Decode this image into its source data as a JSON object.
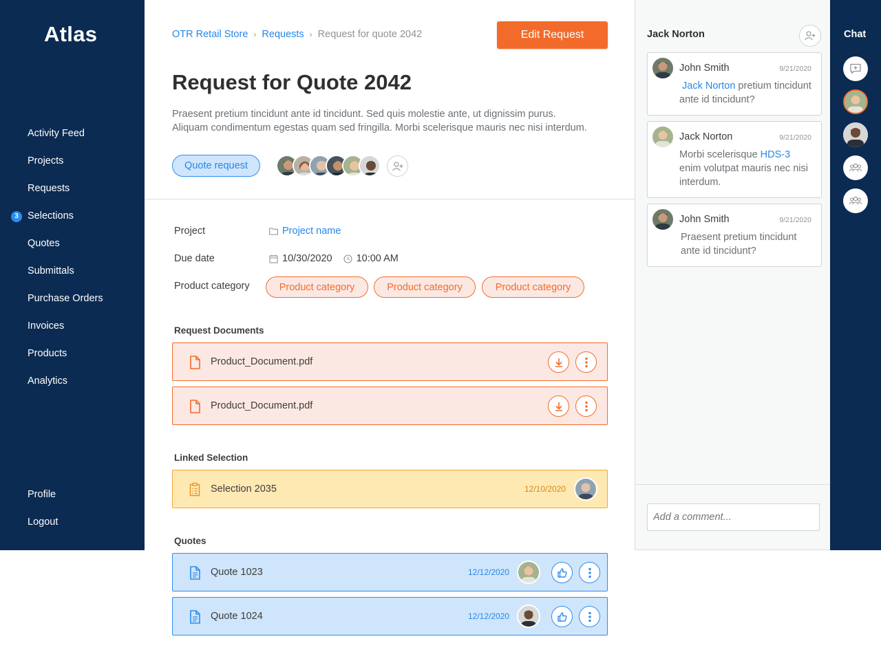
{
  "sidebar": {
    "logo": "Atlas",
    "items": [
      {
        "label": "Activity Feed"
      },
      {
        "label": "Projects"
      },
      {
        "label": "Requests"
      },
      {
        "label": "Selections",
        "badge": "3"
      },
      {
        "label": "Quotes"
      },
      {
        "label": "Submittals"
      },
      {
        "label": "Purchase Orders"
      },
      {
        "label": "Invoices"
      },
      {
        "label": "Products"
      },
      {
        "label": "Analytics"
      }
    ],
    "bottom_items": [
      {
        "label": "Profile"
      },
      {
        "label": "Logout"
      }
    ]
  },
  "breadcrumb": {
    "items": [
      "OTR Retail Store",
      "Requests"
    ],
    "current": "Request for quote 2042"
  },
  "header": {
    "edit_button": "Edit Request",
    "title": "Request for Quote 2042",
    "description_line1": "Praesent pretium tincidunt ante id tincidunt. Sed quis molestie ante, ut dignissim purus.",
    "description_line2": "Aliquam condimentum egestas quam sed fringilla. Morbi scelerisque mauris nec nisi interdum.",
    "type_tag": "Quote request"
  },
  "details": {
    "project_label": "Project",
    "project_value": "Project name",
    "due_label": "Due date",
    "due_date": "10/30/2020",
    "due_time": "10:00 AM",
    "category_label": "Product category",
    "categories": [
      "Product category",
      "Product category",
      "Product category"
    ]
  },
  "request_documents": {
    "title": "Request Documents",
    "items": [
      {
        "name": "Product_Document.pdf"
      },
      {
        "name": "Product_Document.pdf"
      }
    ]
  },
  "linked_selection": {
    "title": "Linked Selection",
    "name": "Selection 2035",
    "date": "12/10/2020"
  },
  "quotes": {
    "title": "Quotes",
    "items": [
      {
        "name": "Quote 1023",
        "date": "12/12/2020"
      },
      {
        "name": "Quote 1024",
        "date": "12/12/2020"
      }
    ]
  },
  "comments_panel": {
    "title": "Jack Norton",
    "comments": [
      {
        "author": "John Smith",
        "date": "9/21/2020",
        "mention": "Jack Norton",
        "text_before": "",
        "text_after": " pretium tincidunt ante id tincidunt?"
      },
      {
        "author": "Jack Norton",
        "date": "9/21/2020",
        "mention": "HDS-3",
        "text_before": "Morbi scelerisque ",
        "text_after": " enim volutpat mauris nec nisi interdum."
      },
      {
        "author": "John Smith",
        "date": "9/21/2020",
        "mention": "",
        "text_before": "Praesent pretium tincidunt ante id tincidunt?",
        "text_after": ""
      }
    ],
    "input_placeholder": "Add a comment..."
  },
  "chat": {
    "title": "Chat"
  },
  "colors": {
    "navy": "#0b2b52",
    "accent_orange": "#f36b2b",
    "accent_blue": "#2d8cf0",
    "selection_yellow": "#ffe9b3"
  }
}
